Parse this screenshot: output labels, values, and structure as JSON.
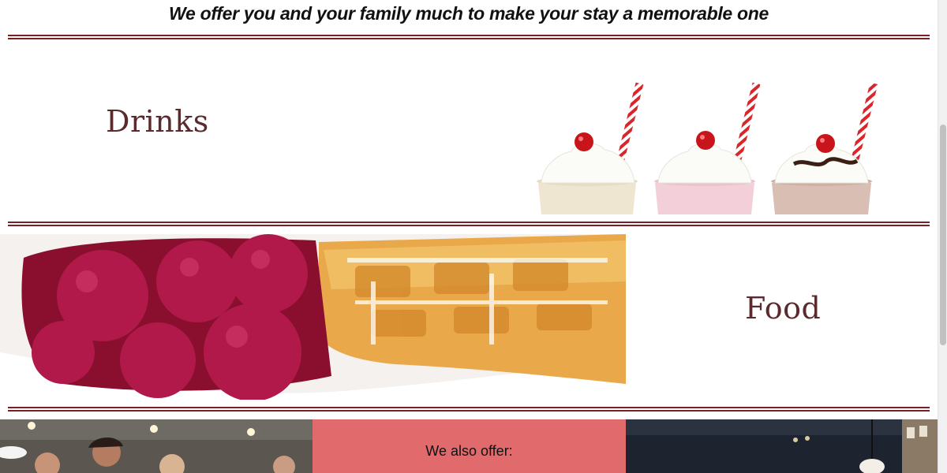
{
  "tagline": "We offer you and your family much to make your stay a memorable one",
  "sections": {
    "drinks_title": "Drinks",
    "food_title": "Food"
  },
  "bottom": {
    "offer_label": "We also offer:"
  },
  "colors": {
    "accent_rule": "#7a1f24",
    "title_color": "#5a2a2e",
    "offer_bg": "#e06a6c"
  },
  "icons": {
    "drinks_image": "milkshakes-image",
    "food_image": "waffle-raspberries-image",
    "people_image": "restaurant-guests-image",
    "interior_image": "restaurant-interior-image"
  }
}
